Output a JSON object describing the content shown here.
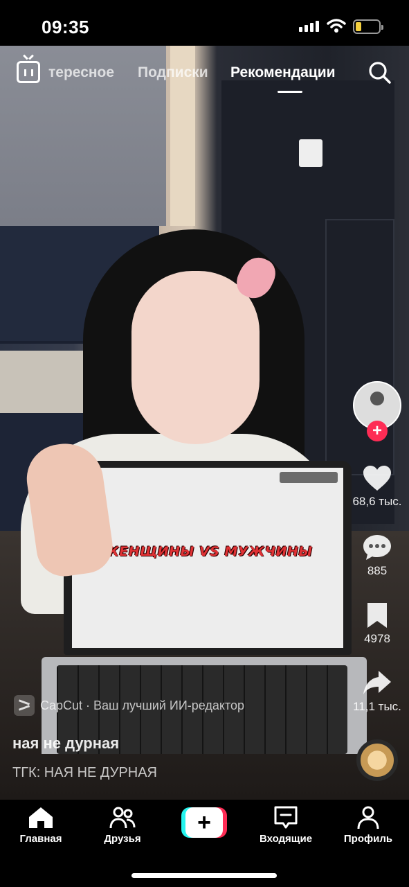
{
  "status_bar": {
    "time": "09:35",
    "battery_level": 0.2,
    "icons": [
      "signal-icon",
      "wifi-icon",
      "battery-icon"
    ]
  },
  "top_nav": {
    "tabs": [
      {
        "label": "Интересное",
        "visible_text": "тересное",
        "active": false
      },
      {
        "label": "Подписки",
        "active": false
      },
      {
        "label": "Рекомендации",
        "active": true
      }
    ],
    "icons": [
      "live-tv-icon",
      "search-icon"
    ]
  },
  "video": {
    "laptop_text": "ЖЕНЩИНЫ VS МУЖЧИНЫ"
  },
  "right_rail": {
    "likes": "68,6 тыс.",
    "comments": "885",
    "favorites": "4978",
    "shares": "11,1 тыс.",
    "follow_symbol": "+"
  },
  "caption": {
    "capcut": "CapCut · Ваш лучший ИИ-редактор",
    "author": "ная не дурная",
    "description": "ТГК: НАЯ НЕ ДУРНАЯ"
  },
  "bottom_nav": {
    "items": [
      {
        "label": "Главная",
        "icon": "home-icon"
      },
      {
        "label": "Друзья",
        "icon": "friends-icon"
      },
      {
        "label": "",
        "icon": "create-plus-icon"
      },
      {
        "label": "Входящие",
        "icon": "inbox-icon"
      },
      {
        "label": "Профиль",
        "icon": "profile-icon"
      }
    ],
    "plus_symbol": "+"
  },
  "colors": {
    "accent_red": "#fe2c55",
    "accent_cyan": "#25f4ee",
    "battery_yellow": "#f4d03f"
  }
}
